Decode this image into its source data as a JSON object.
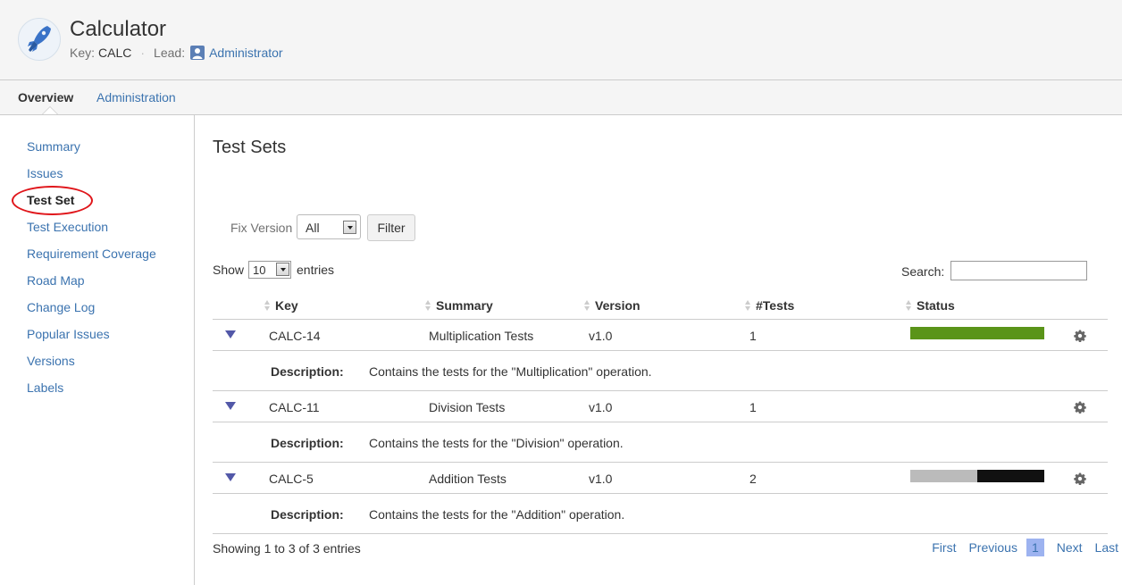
{
  "project": {
    "title": "Calculator",
    "key_label": "Key:",
    "key_value": "CALC",
    "separator": "·",
    "lead_label": "Lead:",
    "lead_value": "Administrator"
  },
  "nav": {
    "tabs": [
      {
        "label": "Overview",
        "active": true
      },
      {
        "label": "Administration",
        "active": false
      }
    ]
  },
  "sidebar": {
    "items": [
      {
        "label": "Summary"
      },
      {
        "label": "Issues"
      },
      {
        "label": "Test Set",
        "active": true
      },
      {
        "label": "Test Execution"
      },
      {
        "label": "Requirement Coverage"
      },
      {
        "label": "Road Map"
      },
      {
        "label": "Change Log"
      },
      {
        "label": "Popular Issues"
      },
      {
        "label": "Versions"
      },
      {
        "label": "Labels"
      }
    ],
    "highlight_color": "#e0161b"
  },
  "main": {
    "title": "Test Sets",
    "filter": {
      "fix_version_label": "Fix Version",
      "fix_version_value": "All",
      "filter_button": "Filter"
    },
    "length": {
      "show_label": "Show",
      "value": "10",
      "entries_label": "entries"
    },
    "search": {
      "label": "Search:",
      "value": ""
    },
    "table": {
      "columns": [
        "Key",
        "Summary",
        "Version",
        "#Tests",
        "Status"
      ],
      "description_label": "Description:",
      "rows": [
        {
          "key": "CALC-14",
          "summary": "Multiplication Tests",
          "version": "v1.0",
          "tests": "1",
          "status": [
            {
              "fraction": 1.0,
              "color": "#5a9419"
            }
          ],
          "description": "Contains the tests for the \"Multiplication\" operation."
        },
        {
          "key": "CALC-11",
          "summary": "Division Tests",
          "version": "v1.0",
          "tests": "1",
          "status": [],
          "description": "Contains the tests for the \"Division\" operation."
        },
        {
          "key": "CALC-5",
          "summary": "Addition Tests",
          "version": "v1.0",
          "tests": "2",
          "status": [
            {
              "fraction": 0.5,
              "color": "#bbbbbb"
            },
            {
              "fraction": 0.5,
              "color": "#111111"
            }
          ],
          "description": "Contains the tests for the \"Addition\" operation."
        }
      ]
    },
    "info": "Showing 1 to 3 of 3 entries",
    "pagination": {
      "first": "First",
      "previous": "Previous",
      "current": "1",
      "next": "Next",
      "last": "Last"
    }
  },
  "colors": {
    "link": "#3b73af",
    "header_bg": "#f5f5f5",
    "expand_icon": "#5258a8",
    "current_page_bg": "#9db3f0"
  }
}
